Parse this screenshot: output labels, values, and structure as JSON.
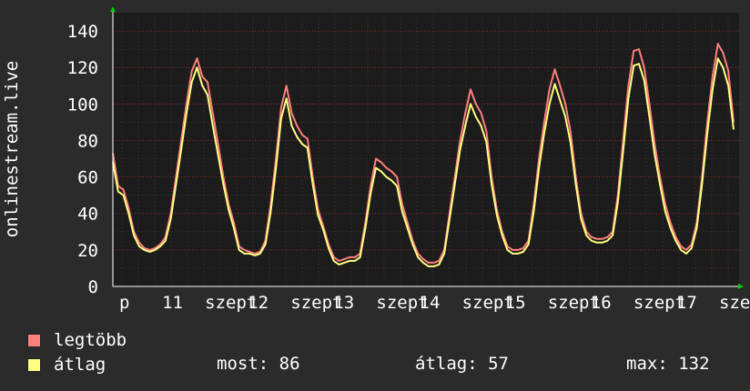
{
  "chart_data": {
    "type": "line",
    "ylabel": "onlinestream.live",
    "ylim": [
      0,
      150
    ],
    "yticks": [
      0,
      20,
      40,
      60,
      80,
      100,
      120,
      140
    ],
    "grid": true,
    "xtick_labels": [
      "p",
      "11",
      "szept",
      "12",
      "szept",
      "13",
      "szept",
      "14",
      "szept",
      "15",
      "szept",
      "16",
      "szept",
      "17",
      "szept"
    ],
    "series": [
      {
        "name": "legtöbb",
        "color": "#ff7f7f",
        "values": [
          73,
          55,
          53,
          43,
          30,
          24,
          21,
          20,
          21,
          23,
          27,
          40,
          60,
          80,
          100,
          118,
          125,
          115,
          112,
          95,
          78,
          60,
          45,
          35,
          22,
          20,
          19,
          18,
          19,
          25,
          45,
          70,
          98,
          110,
          95,
          88,
          83,
          81,
          60,
          42,
          33,
          23,
          16,
          14,
          15,
          16,
          16,
          18,
          35,
          55,
          70,
          68,
          65,
          63,
          60,
          45,
          35,
          25,
          18,
          15,
          13,
          13,
          14,
          20,
          40,
          60,
          80,
          95,
          108,
          100,
          95,
          85,
          60,
          42,
          30,
          22,
          20,
          20,
          21,
          25,
          45,
          70,
          90,
          108,
          119,
          110,
          100,
          85,
          60,
          40,
          30,
          27,
          26,
          26,
          27,
          30,
          50,
          80,
          110,
          129,
          130,
          120,
          100,
          78,
          60,
          45,
          35,
          27,
          22,
          20,
          23,
          35,
          60,
          90,
          115,
          133,
          128,
          118,
          90
        ]
      },
      {
        "name": "átlag",
        "color": "#ffff80",
        "values": [
          68,
          52,
          50,
          40,
          28,
          22,
          20,
          19,
          20,
          22,
          25,
          37,
          56,
          75,
          95,
          112,
          120,
          110,
          105,
          88,
          72,
          56,
          42,
          32,
          20,
          18,
          18,
          17,
          18,
          23,
          41,
          65,
          92,
          103,
          88,
          82,
          78,
          76,
          56,
          39,
          31,
          21,
          14,
          12,
          13,
          14,
          14,
          16,
          32,
          51,
          65,
          63,
          60,
          58,
          55,
          41,
          32,
          23,
          16,
          13,
          11,
          11,
          12,
          18,
          37,
          56,
          75,
          88,
          100,
          93,
          88,
          79,
          56,
          39,
          28,
          20,
          18,
          18,
          19,
          23,
          41,
          65,
          84,
          100,
          111,
          102,
          93,
          79,
          56,
          37,
          28,
          25,
          24,
          24,
          25,
          28,
          46,
          74,
          103,
          121,
          122,
          113,
          93,
          72,
          56,
          41,
          32,
          25,
          20,
          18,
          21,
          32,
          56,
          84,
          108,
          125,
          120,
          110,
          86
        ]
      }
    ]
  },
  "stats": {
    "most_label": "most: 86",
    "atlag_label": "átlag: 57",
    "max_label": "max: 132"
  }
}
